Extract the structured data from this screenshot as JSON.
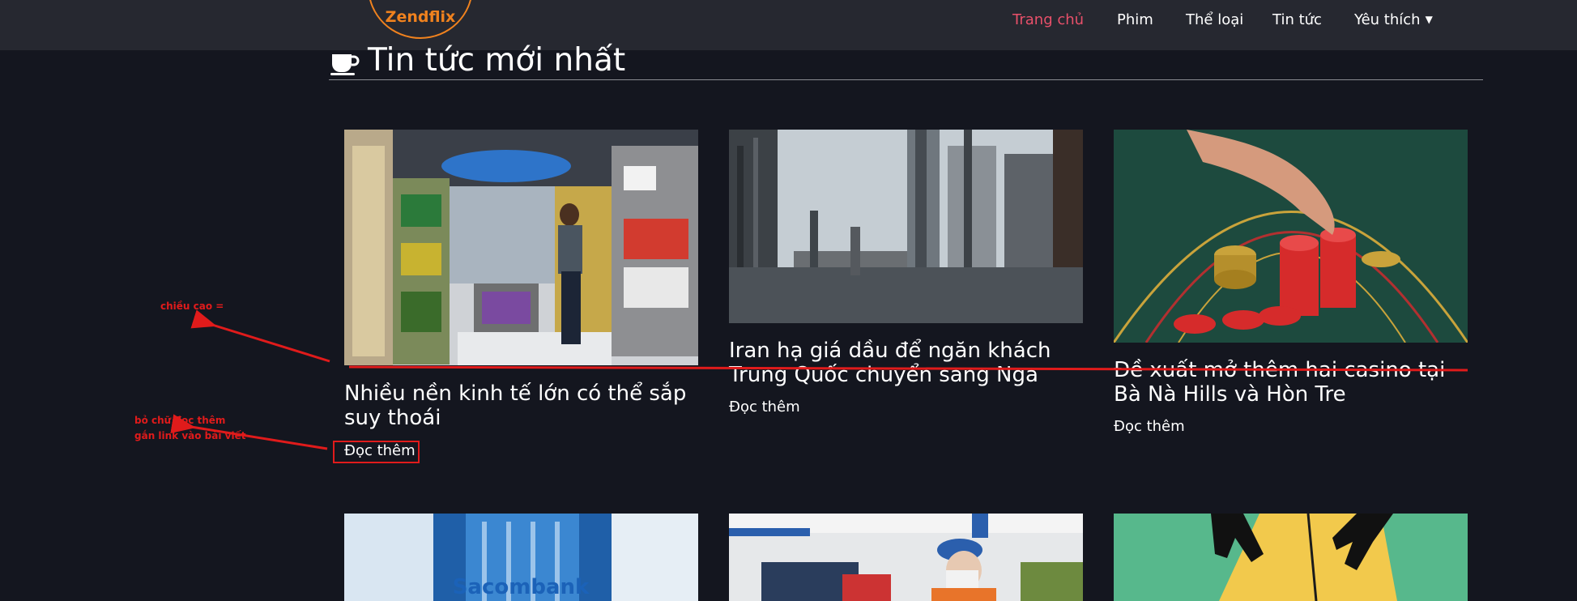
{
  "brand": {
    "logo_text": "Zendflix",
    "accent": "#f0821e"
  },
  "nav": {
    "items": [
      "Trang chủ",
      "Phim",
      "Thể loại",
      "Tin tức",
      "Yêu thích"
    ],
    "active_color": "#e8506a"
  },
  "section": {
    "title": "Tin tức mới nhất",
    "icon": "coffee-cup-icon"
  },
  "articles": [
    {
      "title": "Nhiều nền kinh tế lớn có thể sắp suy thoái",
      "read_more": "Đọc thêm",
      "image": "supermarket-aisle-photo"
    },
    {
      "title": "Iran hạ giá dầu để ngăn khách Trung Quốc chuyển sang Nga",
      "read_more": "Đọc thêm",
      "image": "oil-refinery-photo"
    },
    {
      "title": "Đề xuất mở thêm hai casino tại Bà Nà Hills và Hòn Tre",
      "read_more": "Đọc thêm",
      "image": "casino-chips-photo"
    },
    {
      "image": "sacombank-building-photo",
      "image_text": "Sacombank"
    },
    {
      "image": "gas-station-worker-photo"
    },
    {
      "image": "hands-illustration-photo"
    }
  ],
  "annotations": {
    "height_note": "chiều cao =",
    "remove_note_line1": "bỏ chữ đọc thêm",
    "remove_note_line2": "gắn link vào bài viết",
    "color": "#e01b1b"
  }
}
